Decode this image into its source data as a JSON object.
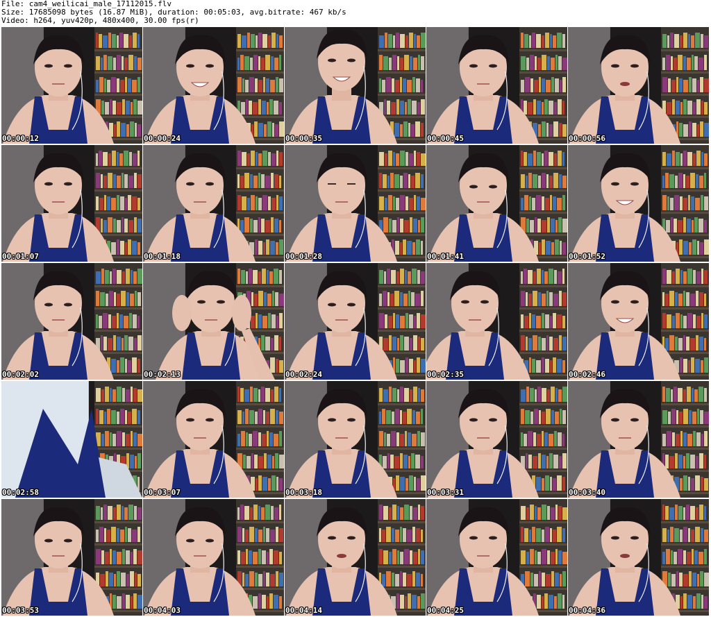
{
  "header": {
    "file_line": "File: cam4_weilicai_male_17112015.flv",
    "size_line": "Size: 17685098 bytes (16.87 MiB), duration: 00:05:03, avg.bitrate: 467 kb/s",
    "video_line": "Video: h264, yuv420p, 480x400, 30.00 fps(r)"
  },
  "colors": {
    "background": "#ffffff",
    "room_dark": "#1c1a1a",
    "shelf_tones": [
      "#3b3530",
      "#5a4a3c",
      "#2e2a26"
    ],
    "skin": "#e8c2b0",
    "tank_top": "#1b2a7a",
    "stamp_text": "#ffffff"
  },
  "thumbnails": [
    {
      "time": "00:00:12",
      "pose": "neutral"
    },
    {
      "time": "00:00:24",
      "pose": "smile"
    },
    {
      "time": "00:00:35",
      "pose": "talking-up"
    },
    {
      "time": "00:00:45",
      "pose": "neutral"
    },
    {
      "time": "00:00:56",
      "pose": "talking"
    },
    {
      "time": "00:01:07",
      "pose": "neutral"
    },
    {
      "time": "00:01:18",
      "pose": "neutral"
    },
    {
      "time": "00:01:28",
      "pose": "eyes-closed"
    },
    {
      "time": "00:01:41",
      "pose": "looking-down"
    },
    {
      "time": "00:01:52",
      "pose": "laughing"
    },
    {
      "time": "00:02:02",
      "pose": "looking-down"
    },
    {
      "time": "00:02:13",
      "pose": "hands-on-hair"
    },
    {
      "time": "00:02:24",
      "pose": "looking-down"
    },
    {
      "time": "00:02:35",
      "pose": "head-tilted"
    },
    {
      "time": "00:02:46",
      "pose": "laughing"
    },
    {
      "time": "00:02:58",
      "pose": "close-up-chest"
    },
    {
      "time": "00:03:07",
      "pose": "neutral"
    },
    {
      "time": "00:03:18",
      "pose": "neutral"
    },
    {
      "time": "00:03:31",
      "pose": "neutral"
    },
    {
      "time": "00:03:40",
      "pose": "neutral"
    },
    {
      "time": "00:03:53",
      "pose": "looking-down"
    },
    {
      "time": "00:04:03",
      "pose": "looking-down"
    },
    {
      "time": "00:04:14",
      "pose": "talking"
    },
    {
      "time": "00:04:25",
      "pose": "neutral"
    },
    {
      "time": "00:04:36",
      "pose": "talking"
    }
  ]
}
